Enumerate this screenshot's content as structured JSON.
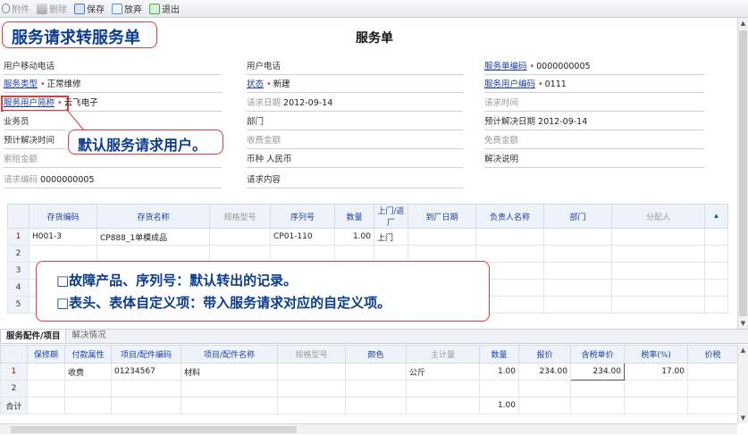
{
  "toolbar": {
    "attach": "附件",
    "delete": "删除",
    "save": "保存",
    "discard": "放弃",
    "exit": "退出"
  },
  "form": {
    "title": "服务单",
    "callout_title": "服务请求转服务单",
    "callout_default_user": "默认服务请求用户。",
    "callout_notes": [
      "□故障产品、序列号：默认转出的记录。",
      "□表头、表体自定义项：带入服务请求对应的自定义项。"
    ],
    "fields": {
      "mobile": {
        "label": "用户移动电话",
        "value": ""
      },
      "phone": {
        "label": "用户电话",
        "value": ""
      },
      "order_no": {
        "label": "服务单编码",
        "value": "0000000005"
      },
      "service_type": {
        "label": "服务类型",
        "value": "正常维修"
      },
      "status": {
        "label": "状态",
        "value": "新建"
      },
      "service_user_code": {
        "label": "服务用户编码",
        "value": "0111"
      },
      "user_short_name": {
        "label": "服务用户简称",
        "value": "云飞电子"
      },
      "request_date": {
        "label": "请求日期",
        "value": "2012-09-14"
      },
      "request_time": {
        "label": "请求时间",
        "value": ""
      },
      "salesman": {
        "label": "业务员",
        "value": ""
      },
      "department": {
        "label": "部门",
        "value": ""
      },
      "expected_date": {
        "label": "预计解决日期",
        "value": "2012-09-14"
      },
      "expected_time": {
        "label": "预计解决时间",
        "value": ""
      },
      "fee": {
        "label": "收费金额",
        "value": ""
      },
      "free_amount": {
        "label": "免费金额",
        "value": ""
      },
      "claim_amount": {
        "label": "索赔金额",
        "value": ""
      },
      "currency": {
        "label": "币种",
        "value": "人民币"
      },
      "solution": {
        "label": "解决说明",
        "value": ""
      },
      "request_no": {
        "label": "请求编码",
        "value": "0000000005"
      },
      "request_content": {
        "label": "请求内容",
        "value": ""
      }
    }
  },
  "upper_table": {
    "headers": [
      "存货编码",
      "存货名称",
      "规格型号",
      "序列号",
      "数量",
      "上门/返厂",
      "到厂日期",
      "负责人名称",
      "部门",
      "分配人"
    ],
    "rows": [
      {
        "num": "1",
        "cells": [
          "H001-3",
          "CP888_1单模成品",
          "",
          "CP01-110",
          "1.00",
          "上门",
          "",
          "",
          "",
          ""
        ]
      },
      {
        "num": "2",
        "cells": [
          "",
          "",
          "",
          "",
          "",
          "",
          "",
          "",
          "",
          ""
        ]
      },
      {
        "num": "3",
        "cells": [
          "",
          "",
          "",
          "",
          "",
          "",
          "",
          "",
          "",
          ""
        ]
      },
      {
        "num": "4",
        "cells": [
          "",
          "",
          "",
          "",
          "",
          "",
          "",
          "",
          "",
          ""
        ]
      },
      {
        "num": "5",
        "cells": [
          "",
          "",
          "",
          "",
          "",
          "",
          "",
          "",
          "",
          ""
        ]
      }
    ]
  },
  "tabs": [
    "服务配件/项目",
    "解决情况"
  ],
  "lower_table": {
    "headers": [
      "保修期",
      "付款属性",
      "项目/配件编码",
      "项目/配件名称",
      "规格型号",
      "颜色",
      "主计量",
      "数量",
      "报价",
      "含税单价",
      "税率(%)",
      "价税"
    ],
    "rows": [
      {
        "num": "1",
        "cells": [
          "",
          "收费",
          "01234567",
          "材料",
          "",
          "",
          "公斤",
          "1.00",
          "234.00",
          "234.00",
          "17.00",
          ""
        ]
      },
      {
        "num": "2",
        "cells": [
          "",
          "",
          "",
          "",
          "",
          "",
          "",
          "",
          "",
          "",
          "",
          ""
        ]
      },
      {
        "num": "合计",
        "cells": [
          "",
          "",
          "",
          "",
          "",
          "",
          "",
          "1.00",
          "",
          "",
          "",
          ""
        ]
      }
    ]
  },
  "colors": {
    "callout_border": "#e23b3b",
    "callout_text": "#0b3d8c",
    "link_label": "#1a3ea8",
    "header_bg": "#eef3fa"
  }
}
